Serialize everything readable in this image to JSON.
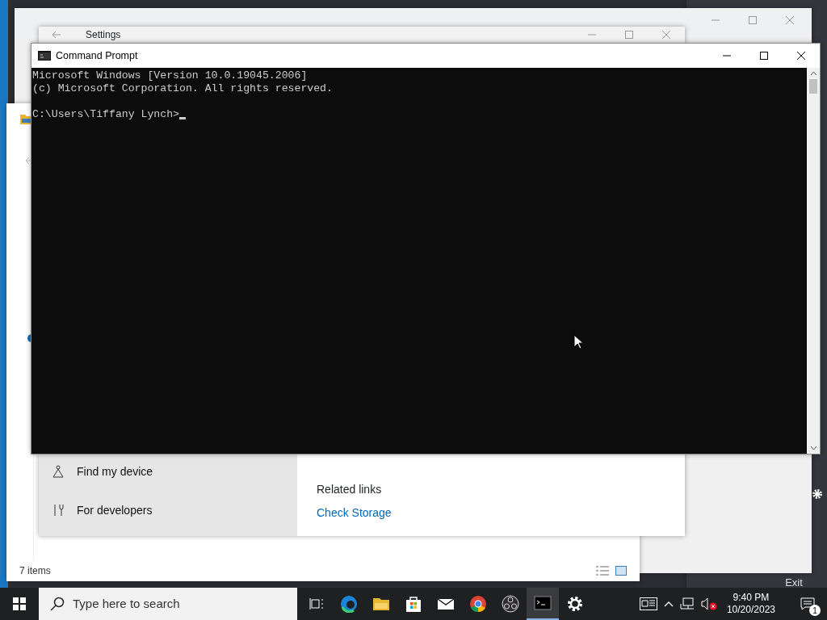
{
  "command_prompt": {
    "title": "Command Prompt",
    "output": [
      "Microsoft Windows [Version 10.0.19045.2006]",
      "(c) Microsoft Corporation. All rights reserved."
    ],
    "prompt": "C:\\Users\\Tiffany Lynch>"
  },
  "settings": {
    "title": "Settings",
    "nav_items": [
      {
        "kind": "device",
        "label": "Find my device"
      },
      {
        "kind": "developers",
        "label": "For developers"
      }
    ],
    "related_heading": "Related links",
    "related_links": [
      "Check Storage"
    ]
  },
  "file_explorer": {
    "status": "7 items"
  },
  "background_window": {
    "button": "Exit"
  },
  "taskbar": {
    "search": {
      "placeholder": "Type here to search"
    },
    "apps": [
      {
        "kind": "edge",
        "selected": false
      },
      {
        "kind": "explorer",
        "selected": false
      },
      {
        "kind": "store",
        "selected": false
      },
      {
        "kind": "mail",
        "selected": false
      },
      {
        "kind": "chrome",
        "selected": false
      },
      {
        "kind": "obs",
        "selected": false
      },
      {
        "kind": "terminal",
        "selected": true
      },
      {
        "kind": "gear",
        "selected": false
      }
    ],
    "clock": {
      "time": "9:40 PM",
      "date": "10/20/2023"
    },
    "notification_count": "1"
  }
}
